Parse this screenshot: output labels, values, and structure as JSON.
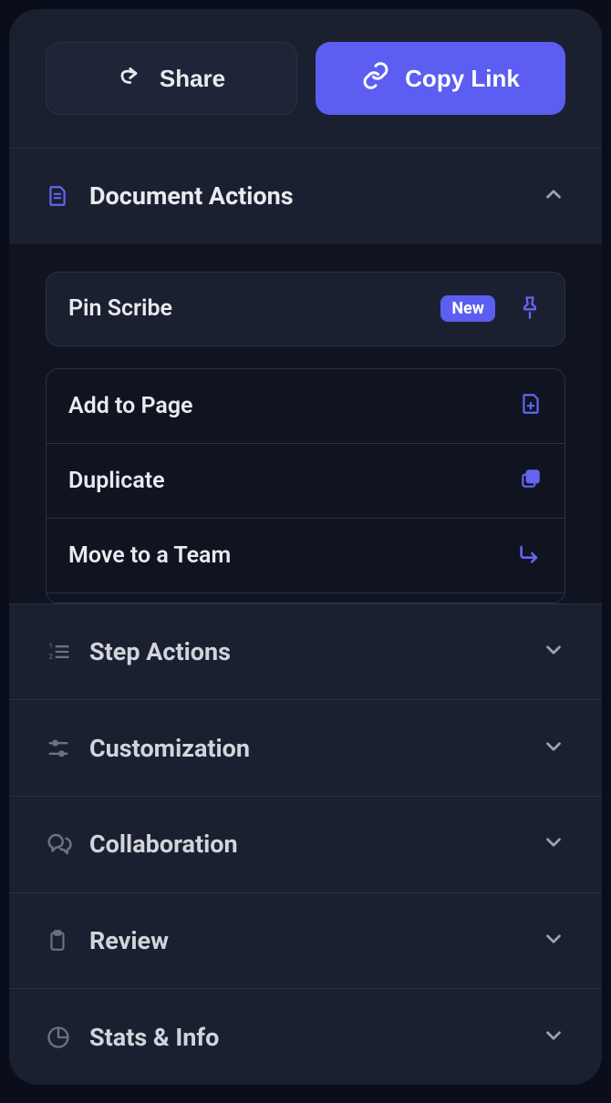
{
  "topButtons": {
    "share": "Share",
    "copyLink": "Copy Link"
  },
  "sections": {
    "documentActions": {
      "label": "Document Actions",
      "items": {
        "pin": {
          "label": "Pin Scribe",
          "badge": "New"
        },
        "addToPage": {
          "label": "Add to Page"
        },
        "duplicate": {
          "label": "Duplicate"
        },
        "moveToTeam": {
          "label": "Move to a Team"
        }
      }
    },
    "stepActions": {
      "label": "Step Actions"
    },
    "customization": {
      "label": "Customization"
    },
    "collaboration": {
      "label": "Collaboration"
    },
    "review": {
      "label": "Review"
    },
    "statsInfo": {
      "label": "Stats & Info"
    }
  }
}
